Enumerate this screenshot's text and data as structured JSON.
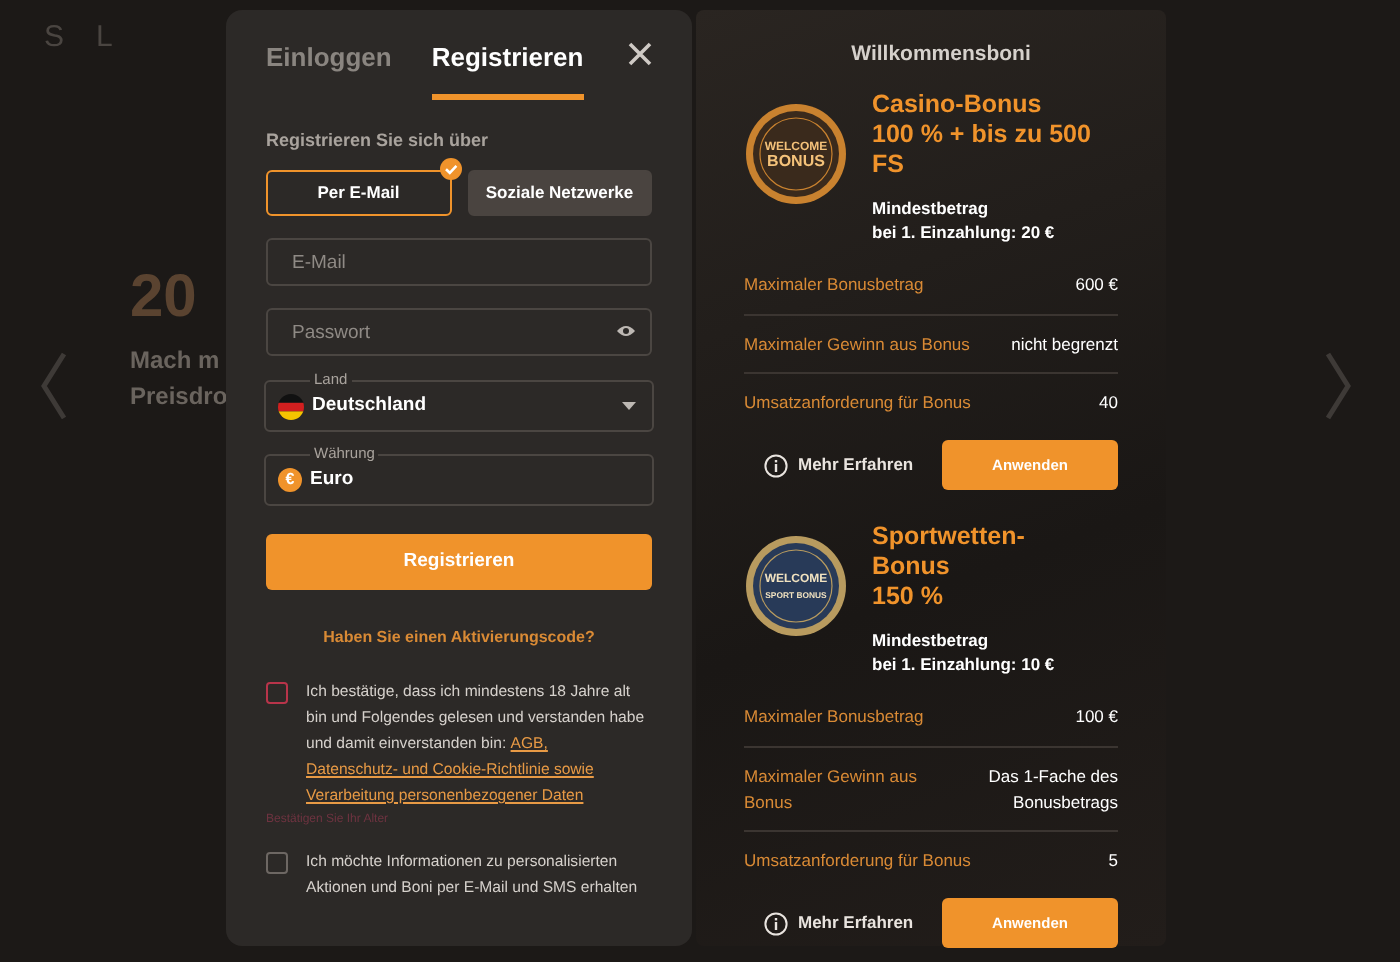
{
  "backdrop": {
    "logo_letters": [
      "S",
      "L"
    ],
    "hero_number": "20",
    "hero_lines": [
      "Mach m",
      "Preisdro"
    ]
  },
  "auth": {
    "tabs": [
      {
        "label": "Einloggen",
        "selected": false
      },
      {
        "label": "Registrieren",
        "selected": true
      }
    ],
    "subtitle": "Registrieren Sie sich über",
    "methods": [
      {
        "label": "Per E-Mail",
        "selected": true
      },
      {
        "label": "Soziale Netzwerke",
        "selected": false
      }
    ],
    "fields": [
      {
        "kind": "text",
        "placeholder": "E-Mail"
      },
      {
        "kind": "password",
        "placeholder": "Passwort"
      },
      {
        "kind": "select",
        "label": "Land",
        "value": "Deutschland"
      },
      {
        "kind": "currency",
        "label": "Währung",
        "value": "Euro",
        "symbol": "€"
      }
    ],
    "submit": "Registrieren",
    "activation_link": "Haben Sie einen Aktivierungscode?",
    "consents": [
      {
        "text": "Ich bestätige, dass ich mindestens 18 Jahre alt bin und Folgendes gelesen und verstanden habe und damit einverstanden bin: ",
        "links": [
          "AGB,",
          "Datenschutz- und Cookie-Richtlinie sowie",
          "Verarbeitung personenbezogener Daten"
        ],
        "checked": false,
        "error": true,
        "error_text": "Bestätigen Sie Ihr Alter"
      },
      {
        "text": "Ich möchte Informationen zu personalisierten Aktionen und Boni per E-Mail und SMS erhalten",
        "checked": false,
        "error": false
      }
    ]
  },
  "bonuses": {
    "title": "Willkommensboni",
    "items": [
      {
        "kind": "casino",
        "badge_text": [
          "WELCOME",
          "BONUS"
        ],
        "title_lines": [
          "Casino-Bonus",
          "100 % + bis zu 500",
          "FS"
        ],
        "min_deposit": [
          "Mindestbetrag",
          "bei 1. Einzahlung: 20 €"
        ],
        "rows": [
          {
            "label": "Maximaler Bonusbetrag",
            "value": "600 €"
          },
          {
            "label": "Maximaler Gewinn aus Bonus",
            "value": "nicht begrenzt"
          },
          {
            "label": "Umsatzanforderung für Bonus",
            "value": "40"
          }
        ],
        "more": "Mehr Erfahren",
        "apply": "Anwenden"
      },
      {
        "kind": "sport",
        "badge_text": [
          "WELCOME",
          "SPORT BONUS"
        ],
        "title_lines": [
          "Sportwetten-",
          "Bonus",
          "150 %"
        ],
        "min_deposit": [
          "Mindestbetrag",
          "bei 1. Einzahlung: 10 €"
        ],
        "rows": [
          {
            "label": "Maximaler Bonusbetrag",
            "value": "100 €"
          },
          {
            "label": "Maximaler Gewinn aus Bonus",
            "value": "Das 1-Fache des Bonusbetrags"
          },
          {
            "label": "Umsatzanforderung für Bonus",
            "value": "5"
          }
        ],
        "more": "Mehr Erfahren",
        "apply": "Anwenden"
      }
    ]
  }
}
